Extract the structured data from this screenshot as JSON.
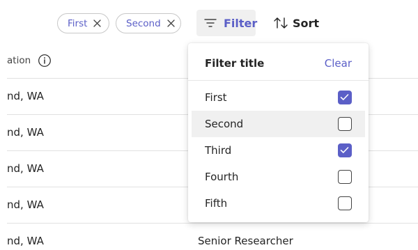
{
  "toolbar": {
    "chips": [
      {
        "label": "First"
      },
      {
        "label": "Second"
      }
    ],
    "filter_label": "Filter",
    "sort_label": "Sort"
  },
  "table": {
    "column_header_partial": "ation",
    "rows": [
      {
        "location": "nd, WA",
        "title": ""
      },
      {
        "location": "nd, WA",
        "title": ""
      },
      {
        "location": "nd, WA",
        "title": ""
      },
      {
        "location": "nd, WA",
        "title": ""
      },
      {
        "location": "nd, WA",
        "title": "Senior Researcher"
      }
    ]
  },
  "filter_panel": {
    "title": "Filter title",
    "clear_label": "Clear",
    "options": [
      {
        "label": "First",
        "checked": true
      },
      {
        "label": "Second",
        "checked": false
      },
      {
        "label": "Third",
        "checked": true
      },
      {
        "label": "Fourth",
        "checked": false
      },
      {
        "label": "Fifth",
        "checked": false
      }
    ]
  },
  "colors": {
    "accent": "#5b5fc7",
    "hover_bg": "#f0f0f0",
    "divider": "#e1e1e1"
  },
  "icons": [
    "dismiss-icon",
    "filter-icon",
    "sort-icon",
    "info-icon",
    "checkmark-icon"
  ]
}
